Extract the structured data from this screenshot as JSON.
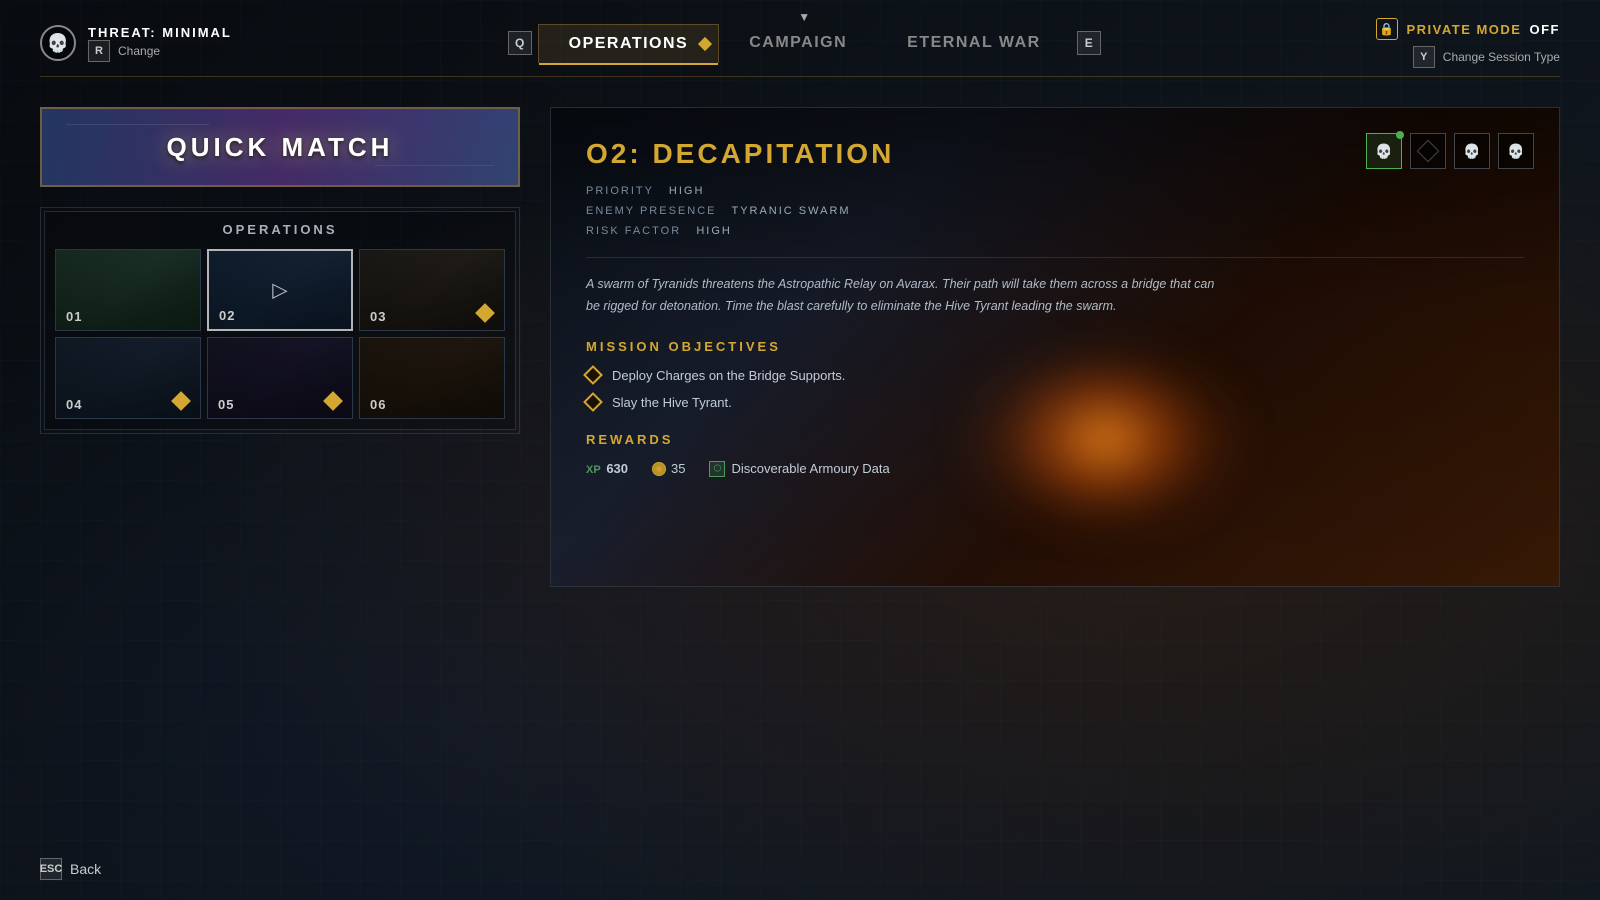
{
  "header": {
    "threat": {
      "label": "THREAT:",
      "value": "MINIMAL",
      "change_key": "R",
      "change_label": "Change"
    },
    "tabs": [
      {
        "id": "q",
        "key": "Q",
        "label": "Operations",
        "active": true
      },
      {
        "id": "campaign",
        "key": null,
        "label": "Campaign",
        "active": false
      },
      {
        "id": "eternal-war",
        "key": null,
        "label": "Eternal War",
        "active": false
      },
      {
        "id": "e",
        "key": "E",
        "label": null,
        "active": false
      }
    ],
    "private_mode": {
      "label": "PRIVATE MODE",
      "value": "OFF"
    },
    "session_type": {
      "key": "Y",
      "label": "Change Session Type"
    }
  },
  "left_panel": {
    "quick_match": {
      "label": "QUICK MATCH"
    },
    "operations": {
      "section_label": "OPERATIONS",
      "tiles": [
        {
          "num": "01",
          "has_icon": false,
          "selected": false
        },
        {
          "num": "02",
          "has_icon": false,
          "selected": true
        },
        {
          "num": "03",
          "has_icon": true,
          "selected": false
        },
        {
          "num": "04",
          "has_icon": true,
          "selected": false
        },
        {
          "num": "05",
          "has_icon": true,
          "selected": false
        },
        {
          "num": "06",
          "has_icon": false,
          "selected": false
        }
      ]
    }
  },
  "mission": {
    "title": "O2: DECAPITATION",
    "meta": {
      "priority_label": "PRIORITY",
      "priority_value": "HIGH",
      "enemy_label": "ENEMY PRESENCE",
      "enemy_value": "TYRANIC SWARM",
      "risk_label": "RISK FACTOR",
      "risk_value": "HIGH"
    },
    "description": "A swarm of Tyranids threatens the Astropathic Relay on Avarax. Their path will take them across a bridge that can be rigged for detonation. Time the blast carefully to eliminate the Hive Tyrant leading the swarm.",
    "objectives_label": "MISSION OBJECTIVES",
    "objectives": [
      {
        "text": "Deploy Charges on the Bridge Supports."
      },
      {
        "text": "Slay the Hive Tyrant."
      }
    ],
    "rewards_label": "REWARDS",
    "rewards": {
      "xp_label": "XP",
      "xp_value": "630",
      "coins_value": "35",
      "data_label": "Discoverable Armoury Data"
    }
  },
  "footer": {
    "back_key": "ESC",
    "back_label": "Back"
  }
}
